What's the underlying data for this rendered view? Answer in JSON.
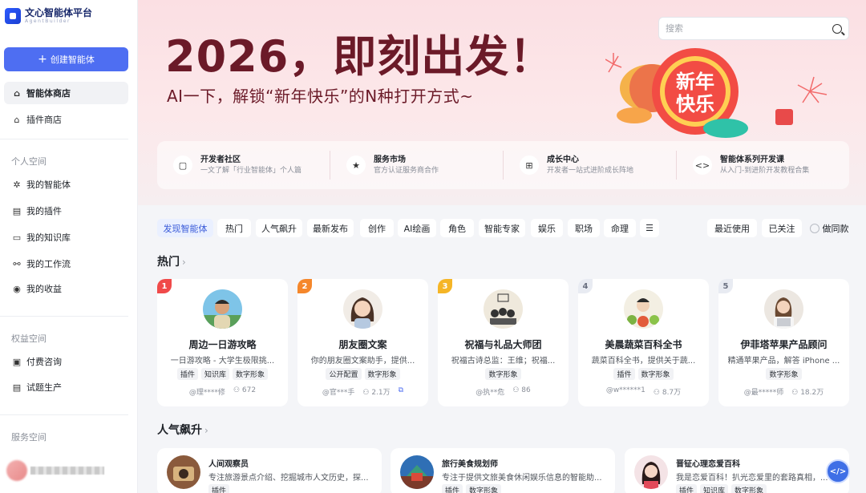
{
  "app": {
    "logo_title": "文心智能体平台",
    "logo_subtitle": "AgentBuilder"
  },
  "sidebar": {
    "create_label": "创建智能体",
    "top_items": [
      {
        "label": "智能体商店",
        "icon": "store-icon"
      },
      {
        "label": "插件商店",
        "icon": "plugin-store-icon"
      }
    ],
    "personal_title": "个人空间",
    "personal_items": [
      {
        "label": "我的智能体",
        "icon": "agent-icon"
      },
      {
        "label": "我的插件",
        "icon": "plugin-icon"
      },
      {
        "label": "我的知识库",
        "icon": "knowledge-icon"
      },
      {
        "label": "我的工作流",
        "icon": "workflow-icon"
      },
      {
        "label": "我的收益",
        "icon": "income-icon"
      }
    ],
    "rights_title": "权益空间",
    "rights_items": [
      {
        "label": "付费咨询",
        "icon": "consult-icon"
      },
      {
        "label": "试题生产",
        "icon": "exam-icon"
      }
    ],
    "service_title": "服务空间"
  },
  "search": {
    "placeholder": "搜索"
  },
  "banner": {
    "title": "2026，即刻出发！",
    "subtitle": "AI一下，解锁“新年快乐”的N种打开方式~",
    "badge_line1": "新年",
    "badge_line2": "快乐"
  },
  "quick_links": [
    {
      "title": "开发者社区",
      "desc": "一文了解「行业智能体」个人篇",
      "icon": "chat-icon"
    },
    {
      "title": "服务市场",
      "desc": "官方认证服务商合作",
      "icon": "badge-icon"
    },
    {
      "title": "成长中心",
      "desc": "开发者一站式进阶成长阵地",
      "icon": "gift-icon"
    },
    {
      "title": "智能体系列开发课",
      "desc": "从入门-到进阶开发教程合集",
      "icon": "code-icon"
    }
  ],
  "categories": [
    "发现智能体",
    "热门",
    "人气飙升",
    "最新发布",
    "创作",
    "AI绘画",
    "角色",
    "智能专家",
    "娱乐",
    "职场",
    "命理"
  ],
  "filters": {
    "recent": "最近使用",
    "followed": "已关注",
    "same": "做同款"
  },
  "hot": {
    "title": "热门",
    "cards": [
      {
        "rank": "1",
        "name": "周边一日游攻略",
        "desc": "一日游攻略 - 大学生极限挑...",
        "tags": [
          "插件",
          "知识库",
          "数字形象"
        ],
        "author": "@理****修",
        "users": "672"
      },
      {
        "rank": "2",
        "name": "朋友圈文案",
        "desc": "你的朋友圈文案助手，提供...",
        "tags": [
          "公开配置",
          "数字形象"
        ],
        "author": "@官***手",
        "users": "2.1万"
      },
      {
        "rank": "3",
        "name": "祝福与礼品大师团",
        "desc": "祝福古诗总监：王维；祝福...",
        "tags": [
          "数字形象"
        ],
        "author": "@执**危",
        "users": "86"
      },
      {
        "rank": "4",
        "name": "美晨蔬菜百科全书",
        "desc": "蔬菜百科全书，提供关于蔬...",
        "tags": [
          "插件",
          "数字形象"
        ],
        "author": "@w******1",
        "users": "8.7万"
      },
      {
        "rank": "5",
        "name": "伊菲塔苹果产品顾问",
        "desc": "精通苹果产品，解答 iPhone ...",
        "tags": [
          "数字形象"
        ],
        "author": "@最*****师",
        "users": "18.2万"
      }
    ]
  },
  "rising": {
    "title": "人气飙升",
    "cards": [
      {
        "name": "人间观察员",
        "desc": "专注旅游景点介绍、挖掘城市人文历史，探...",
        "tags": [
          "插件"
        ]
      },
      {
        "name": "旅行美食规划师",
        "desc": "专注于提供文旅美食休闲娱乐信息的智能助...",
        "tags": [
          "插件",
          "数字形象"
        ]
      },
      {
        "name": "晋钲心理恋爱百科",
        "desc": "我是恋爱百科！扒光恋爱里的套路真相，...",
        "tags": [
          "插件",
          "知识库",
          "数字形象"
        ]
      }
    ]
  },
  "colors": {
    "accent": "#4e6ef2",
    "hero_text": "#6b1a28",
    "rank1": "#f04a4a",
    "rank2": "#f5872b",
    "rank3": "#f5b526",
    "rank_other": "#e8ebf2"
  }
}
